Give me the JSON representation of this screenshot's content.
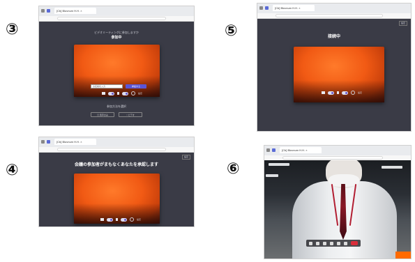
{
  "steps": [
    "③",
    "④",
    "⑤",
    "⑥"
  ],
  "browser": {
    "tab_title": "[Cb] Bluvnum H.H.  ×"
  },
  "shot3": {
    "heading_small": "ビデオミーティングに参加しますか",
    "heading": "参加中",
    "name_placeholder": "お名前を入力",
    "join_label": "参加する",
    "mic_label": "設定",
    "select_label": "参加方法を選択",
    "option_left": "◎ 音声のみ",
    "option_right": "○ ビデオ"
  },
  "shot4": {
    "heading": "会議の参加者がまもなくあなたを承認します",
    "settings_label": "設定"
  },
  "shot5": {
    "heading": "接続中",
    "settings_label": "設定"
  },
  "colors": {
    "panel_bg": "#3a3b46",
    "video_orange": "#f15a14",
    "join_purple": "#5a55d6",
    "hangup_red": "#d92d3a"
  }
}
